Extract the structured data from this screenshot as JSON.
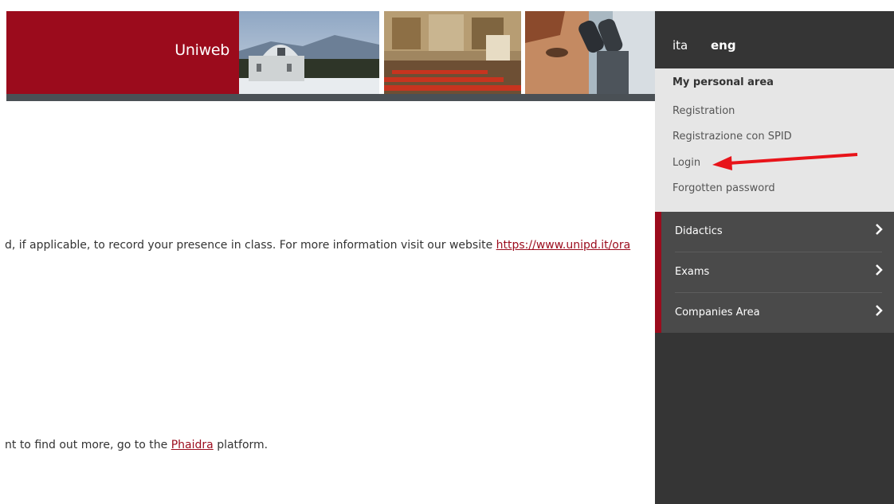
{
  "banner": {
    "brand": "Uniweb"
  },
  "content": {
    "line1_text": "d, if applicable, to record your presence in class. For more information visit our website ",
    "line1_link": "https://www.unipd.it/ora",
    "line2_before": "nt to find out more, go to the ",
    "line2_link": "Phaidra",
    "line2_after": " platform."
  },
  "side": {
    "lang": {
      "ita": "ita",
      "eng": "eng"
    },
    "personal_area": {
      "title": "My personal area",
      "items": [
        "Registration",
        "Registrazione con SPID",
        "Login",
        "Forgotten password"
      ]
    },
    "menu": [
      {
        "label": "Didactics"
      },
      {
        "label": "Exams"
      },
      {
        "label": "Companies Area"
      }
    ]
  },
  "colors": {
    "brand": "#9b0b1c",
    "panel": "#353535",
    "annotation": "#e8141a"
  }
}
